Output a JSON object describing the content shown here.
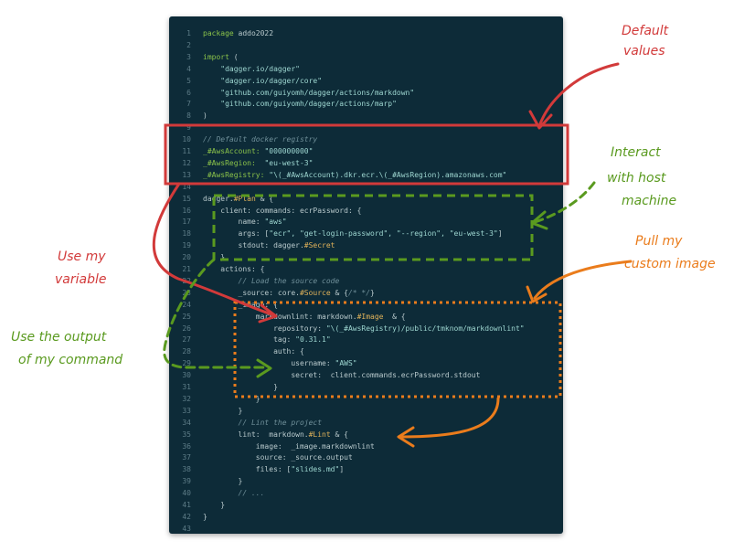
{
  "code_lines": [
    {
      "n": "1",
      "segs": [
        {
          "t": "package ",
          "c": "kw"
        },
        {
          "t": "addo2022",
          "c": "plain"
        }
      ]
    },
    {
      "n": "2",
      "segs": []
    },
    {
      "n": "3",
      "segs": [
        {
          "t": "import ",
          "c": "kw"
        },
        {
          "t": "(",
          "c": "plain"
        }
      ]
    },
    {
      "n": "4",
      "segs": [
        {
          "t": "    \"dagger.io/dagger\"",
          "c": "str"
        }
      ]
    },
    {
      "n": "5",
      "segs": [
        {
          "t": "    \"dagger.io/dagger/core\"",
          "c": "str"
        }
      ]
    },
    {
      "n": "6",
      "segs": [
        {
          "t": "    \"github.com/guiyomh/dagger/actions/markdown\"",
          "c": "str"
        }
      ]
    },
    {
      "n": "7",
      "segs": [
        {
          "t": "    \"github.com/guiyomh/dagger/actions/marp\"",
          "c": "str"
        }
      ]
    },
    {
      "n": "8",
      "segs": [
        {
          "t": ")",
          "c": "plain"
        }
      ]
    },
    {
      "n": "9",
      "segs": []
    },
    {
      "n": "10",
      "segs": [
        {
          "t": "// Default docker registry",
          "c": "cmt"
        }
      ]
    },
    {
      "n": "11",
      "segs": [
        {
          "t": "_#AwsAccount: ",
          "c": "kw"
        },
        {
          "t": "\"000000000\"",
          "c": "str"
        }
      ]
    },
    {
      "n": "12",
      "segs": [
        {
          "t": "_#AwsRegion:  ",
          "c": "kw"
        },
        {
          "t": "\"eu-west-3\"",
          "c": "str"
        }
      ]
    },
    {
      "n": "13",
      "segs": [
        {
          "t": "_#AwsRegistry: ",
          "c": "kw"
        },
        {
          "t": "\"\\(_#AwsAccount).dkr.ecr.\\(_#AwsRegion).amazonaws.com\"",
          "c": "str"
        }
      ]
    },
    {
      "n": "14",
      "segs": []
    },
    {
      "n": "15",
      "segs": [
        {
          "t": "dagger.",
          "c": "plain"
        },
        {
          "t": "#Plan",
          "c": "typ"
        },
        {
          "t": " & {",
          "c": "plain"
        }
      ]
    },
    {
      "n": "16",
      "segs": [
        {
          "t": "    client: commands: ecrPassword: {",
          "c": "plain"
        }
      ]
    },
    {
      "n": "17",
      "segs": [
        {
          "t": "        name: ",
          "c": "plain"
        },
        {
          "t": "\"aws\"",
          "c": "str"
        }
      ]
    },
    {
      "n": "18",
      "segs": [
        {
          "t": "        args: [",
          "c": "plain"
        },
        {
          "t": "\"ecr\", \"get-login-password\", \"--region\", \"eu-west-3\"",
          "c": "str"
        },
        {
          "t": "]",
          "c": "plain"
        }
      ]
    },
    {
      "n": "19",
      "segs": [
        {
          "t": "        stdout: dagger.",
          "c": "plain"
        },
        {
          "t": "#Secret",
          "c": "typ"
        }
      ]
    },
    {
      "n": "20",
      "segs": [
        {
          "t": "    }",
          "c": "plain"
        }
      ]
    },
    {
      "n": "21",
      "segs": [
        {
          "t": "    actions: {",
          "c": "plain"
        }
      ]
    },
    {
      "n": "22",
      "segs": [
        {
          "t": "        // Load the source code",
          "c": "cmt"
        }
      ]
    },
    {
      "n": "23",
      "segs": [
        {
          "t": "        _source: core.",
          "c": "plain"
        },
        {
          "t": "#Source",
          "c": "typ"
        },
        {
          "t": " & {",
          "c": "plain"
        },
        {
          "t": "/* */",
          "c": "cmt"
        },
        {
          "t": "}",
          "c": "plain"
        }
      ]
    },
    {
      "n": "24",
      "segs": [
        {
          "t": "        _image: {",
          "c": "plain"
        }
      ]
    },
    {
      "n": "25",
      "segs": [
        {
          "t": "            markdownlint: markdown.",
          "c": "plain"
        },
        {
          "t": "#Image",
          "c": "typ"
        },
        {
          "t": "  & {",
          "c": "plain"
        }
      ]
    },
    {
      "n": "26",
      "segs": [
        {
          "t": "                repository: ",
          "c": "plain"
        },
        {
          "t": "\"\\(_#AwsRegistry)/public/tmknom/markdownlint\"",
          "c": "str"
        }
      ]
    },
    {
      "n": "27",
      "segs": [
        {
          "t": "                tag: ",
          "c": "plain"
        },
        {
          "t": "\"0.31.1\"",
          "c": "str"
        }
      ]
    },
    {
      "n": "28",
      "segs": [
        {
          "t": "                auth: {",
          "c": "plain"
        }
      ]
    },
    {
      "n": "29",
      "segs": [
        {
          "t": "                    username: ",
          "c": "plain"
        },
        {
          "t": "\"AWS\"",
          "c": "str"
        }
      ]
    },
    {
      "n": "30",
      "segs": [
        {
          "t": "                    secret:  client.commands.ecrPassword.stdout",
          "c": "plain"
        }
      ]
    },
    {
      "n": "31",
      "segs": [
        {
          "t": "                }",
          "c": "plain"
        }
      ]
    },
    {
      "n": "32",
      "segs": [
        {
          "t": "            }",
          "c": "plain"
        }
      ]
    },
    {
      "n": "33",
      "segs": [
        {
          "t": "        }",
          "c": "plain"
        }
      ]
    },
    {
      "n": "34",
      "segs": [
        {
          "t": "        // Lint the project",
          "c": "cmt"
        }
      ]
    },
    {
      "n": "35",
      "segs": [
        {
          "t": "        lint:  markdown.",
          "c": "plain"
        },
        {
          "t": "#Lint",
          "c": "typ"
        },
        {
          "t": " & {",
          "c": "plain"
        }
      ]
    },
    {
      "n": "36",
      "segs": [
        {
          "t": "            image:  _image.markdownlint",
          "c": "plain"
        }
      ]
    },
    {
      "n": "37",
      "segs": [
        {
          "t": "            source: _source.output",
          "c": "plain"
        }
      ]
    },
    {
      "n": "38",
      "segs": [
        {
          "t": "            files: [",
          "c": "plain"
        },
        {
          "t": "\"slides.md\"",
          "c": "str"
        },
        {
          "t": "]",
          "c": "plain"
        }
      ]
    },
    {
      "n": "39",
      "segs": [
        {
          "t": "        }",
          "c": "plain"
        }
      ]
    },
    {
      "n": "40",
      "segs": [
        {
          "t": "        // ...",
          "c": "cmt"
        }
      ]
    },
    {
      "n": "41",
      "segs": [
        {
          "t": "    }",
          "c": "plain"
        }
      ]
    },
    {
      "n": "42",
      "segs": [
        {
          "t": "}",
          "c": "plain"
        }
      ]
    },
    {
      "n": "43",
      "segs": []
    }
  ],
  "annotations": {
    "default_values": [
      "Default",
      "values"
    ],
    "interact_host": [
      "Interact",
      "with host",
      "machine"
    ],
    "pull_image": [
      "Pull my",
      "custom image"
    ],
    "use_variable": [
      "Use my",
      "variable"
    ],
    "use_output": [
      "Use the output",
      "of my command"
    ]
  },
  "colors": {
    "code_bg": "#0d2b38",
    "red": "#d23a3a",
    "green": "#5a9a1f",
    "orange": "#ea7c1c"
  }
}
